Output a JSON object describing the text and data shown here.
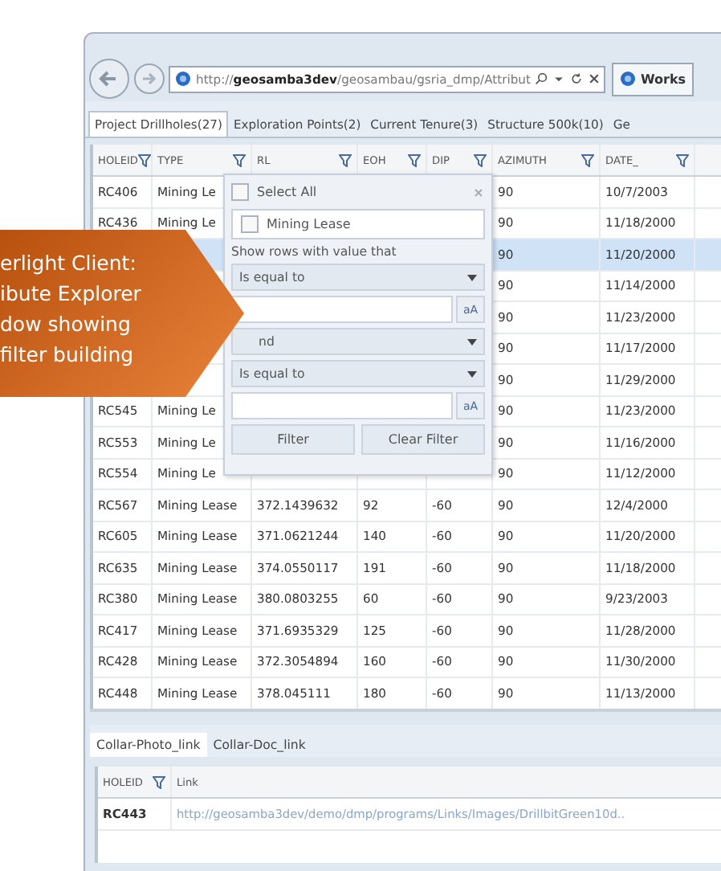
{
  "browser": {
    "address": "http://**geosamba3dev**/geosambau/gsria_dmp/Attribut",
    "tab_title": "Works"
  },
  "tabs": [
    {
      "label": "Project Drillholes(27)",
      "selected": true
    },
    {
      "label": "Exploration Points(2)",
      "selected": false
    },
    {
      "label": "Current Tenure(3)",
      "selected": false
    },
    {
      "label": "Structure 500k(10)",
      "selected": false
    },
    {
      "label": "Ge",
      "selected": false
    }
  ],
  "grid": {
    "columns": [
      "HOLEID",
      "TYPE",
      "RL",
      "EOH",
      "DIP",
      "AZIMUTH",
      "DATE_"
    ],
    "rows": [
      {
        "holeid": "RC406",
        "type": "Mining Le",
        "azimuth": "90",
        "date": "10/7/2003",
        "selected": false
      },
      {
        "holeid": "RC436",
        "type": "Mining Le",
        "azimuth": "90",
        "date": "11/18/2000",
        "selected": false
      },
      {
        "azimuth": "90",
        "date": "11/20/2000",
        "selected": true
      },
      {
        "azimuth": "90",
        "date": "11/14/2000",
        "selected": false
      },
      {
        "azimuth": "90",
        "date": "11/23/2000",
        "selected": false
      },
      {
        "azimuth": "90",
        "date": "11/17/2000",
        "selected": false
      },
      {
        "azimuth": "90",
        "date": "11/29/2000",
        "selected": false
      },
      {
        "holeid": "RC545",
        "type": "Mining Le",
        "azimuth": "90",
        "date": "11/23/2000",
        "selected": false
      },
      {
        "holeid": "RC553",
        "type": "Mining Le",
        "azimuth": "90",
        "date": "11/16/2000",
        "selected": false
      },
      {
        "holeid": "RC554",
        "type": "Mining Le",
        "azimuth": "90",
        "date": "11/12/2000",
        "selected": false
      },
      {
        "holeid": "RC567",
        "type": "Mining Lease",
        "rl": "372.1439632",
        "eoh": "92",
        "dip": "-60",
        "azimuth": "90",
        "date": "12/4/2000",
        "selected": false
      },
      {
        "holeid": "RC605",
        "type": "Mining Lease",
        "rl": "371.0621244",
        "eoh": "140",
        "dip": "-60",
        "azimuth": "90",
        "date": "11/20/2000",
        "selected": false
      },
      {
        "holeid": "RC635",
        "type": "Mining Lease",
        "rl": "374.0550117",
        "eoh": "191",
        "dip": "-60",
        "azimuth": "90",
        "date": "11/18/2000",
        "selected": false
      },
      {
        "holeid": "RC380",
        "type": "Mining Lease",
        "rl": "380.0803255",
        "eoh": "60",
        "dip": "-60",
        "azimuth": "90",
        "date": "9/23/2003",
        "selected": false
      },
      {
        "holeid": "RC417",
        "type": "Mining Lease",
        "rl": "371.6935329",
        "eoh": "125",
        "dip": "-60",
        "azimuth": "90",
        "date": "11/28/2000",
        "selected": false
      },
      {
        "holeid": "RC428",
        "type": "Mining Lease",
        "rl": "372.3054894",
        "eoh": "160",
        "dip": "-60",
        "azimuth": "90",
        "date": "11/30/2000",
        "selected": false
      },
      {
        "holeid": "RC448",
        "type": "Mining Lease",
        "rl": "378.045111",
        "eoh": "180",
        "dip": "-60",
        "azimuth": "90",
        "date": "11/13/2000",
        "selected": false
      }
    ]
  },
  "filter_popup": {
    "select_all": {
      "label": "Select All",
      "checked": false
    },
    "values": [
      {
        "label": "Mining Lease",
        "checked": false
      }
    ],
    "prompt": "Show rows with value that",
    "operator_1": "Is equal to",
    "case_button_1": "aA",
    "logic": "nd",
    "operator_2": "Is equal to",
    "case_button_2": "aA",
    "buttons": [
      "Filter",
      "Clear Filter"
    ]
  },
  "callout": {
    "lines": [
      "erlight Client:",
      "ibute Explorer",
      "dow showing",
      "filter building"
    ]
  },
  "detail": {
    "tabs": [
      {
        "label": "Collar-Photo_link",
        "selected": true
      },
      {
        "label": "Collar-Doc_link",
        "selected": false
      }
    ],
    "columns": [
      {
        "label": "HOLEID",
        "filter": true
      },
      {
        "label": "Link",
        "filter": false
      }
    ],
    "rows": [
      {
        "holeid": "RC443",
        "link": "http://geosamba3dev/demo/dmp/programs/Links/Images/DrillbitGreen10d.."
      }
    ]
  }
}
